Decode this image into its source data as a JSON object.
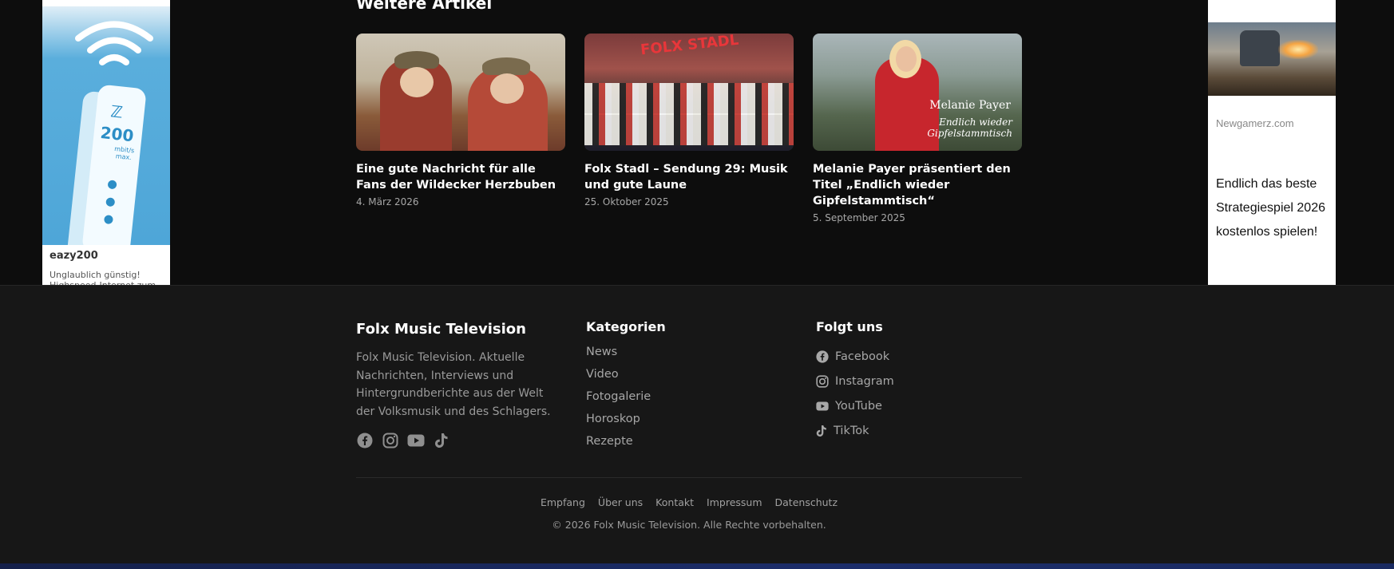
{
  "articles_section": {
    "title": "Weitere Artikel",
    "items": [
      {
        "title": "Eine gute Nachricht für alle Fans der Wildecker Herzbuben",
        "date": "4. März 2026"
      },
      {
        "title": "Folx Stadl – Sendung 29: Musik und gute Laune",
        "date": "25. Oktober 2025",
        "image_text": "FOLX STADL"
      },
      {
        "title": "Melanie Payer präsentiert den Titel „Endlich wieder Gipfelstammtisch“",
        "date": "5. September 2025",
        "image_caption_1": "Melanie Payer",
        "image_caption_2": "Endlich wieder Gipfelstammtisch"
      }
    ]
  },
  "ad_left": {
    "router_speed": "200",
    "router_unit": "mbit/s max.",
    "title": "eazy200",
    "text": "Unglaublich günstig! Highspeed-Internet zum"
  },
  "ad_right": {
    "source": "Newgamerz.com",
    "text": "Endlich das beste Strategiespiel 2026 kostenlos spielen!"
  },
  "footer": {
    "brand": "Folx Music Television",
    "description": "Folx Music Television. Aktuelle Nachrichten, Interviews und Hintergrundberichte aus der Welt der Volksmusik und des Schlagers.",
    "categories_heading": "Kategorien",
    "categories": [
      "News",
      "Video",
      "Fotogalerie",
      "Horoskop",
      "Rezepte"
    ],
    "follow_heading": "Folgt uns",
    "follow": [
      "Facebook",
      "Instagram",
      "YouTube",
      "TikTok"
    ],
    "bottom_links": [
      "Empfang",
      "Über uns",
      "Kontakt",
      "Impressum",
      "Datenschutz"
    ],
    "copyright": "© 2026 Folx Music Television. Alle Rechte vorbehalten."
  },
  "colors": {
    "background": "#0d0d0d",
    "footer_background": "#171717",
    "text": "#ffffff",
    "muted": "#a7a7a7"
  }
}
